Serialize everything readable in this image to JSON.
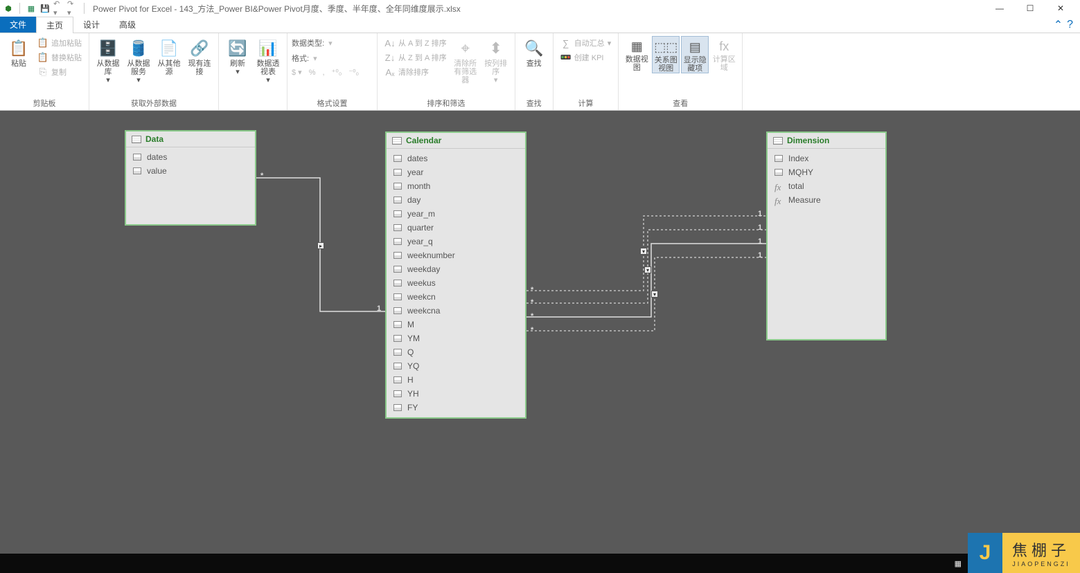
{
  "title": "Power Pivot for Excel - 143_方法_Power BI&Power Pivot月度、季度、半年度、全年同维度展示.xlsx",
  "tabs": {
    "file": "文件",
    "home": "主页",
    "design": "设计",
    "advanced": "高级"
  },
  "ribbon": {
    "clipboard": {
      "paste": "粘贴",
      "append": "追加粘贴",
      "replace": "替换粘贴",
      "copy": "复制",
      "label": "剪贴板"
    },
    "getdata": {
      "db": "从数据库",
      "svc": "从数据服务",
      "other": "从其他源",
      "existing": "现有连接",
      "label": "获取外部数据"
    },
    "refresh": "刷新",
    "pivot": "数据透视表",
    "format": {
      "datatype": "数据类型:",
      "fmt": "格式:",
      "label": "格式设置"
    },
    "sort": {
      "asc": "从 A 到 Z 排序",
      "desc": "从 Z 到 A 排序",
      "clear": "清除排序",
      "clearfilter": "清除所有筛选器",
      "bycol": "按列排序",
      "label": "排序和筛选"
    },
    "find": {
      "find": "查找",
      "label": "查找"
    },
    "calc": {
      "autosum": "自动汇总",
      "kpi": "创建 KPI",
      "label": "计算"
    },
    "view": {
      "dataview": "数据视图",
      "diagram": "关系图视图",
      "hidden": "显示隐藏项",
      "calcarea": "计算区域",
      "label": "查看"
    }
  },
  "tables": {
    "data": {
      "title": "Data",
      "fields": [
        "dates",
        "value"
      ]
    },
    "calendar": {
      "title": "Calendar",
      "fields": [
        "dates",
        "year",
        "month",
        "day",
        "year_m",
        "quarter",
        "year_q",
        "weeknumber",
        "weekday",
        "weekus",
        "weekcn",
        "weekcna",
        "M",
        "YM",
        "Q",
        "YQ",
        "H",
        "YH",
        "FY"
      ]
    },
    "dimension": {
      "title": "Dimension",
      "fields": [
        "Index",
        "MQHY"
      ],
      "measures": [
        "total",
        "Measure"
      ]
    }
  },
  "markers": {
    "star": "*",
    "one": "1"
  },
  "watermark": {
    "letter": "J",
    "name": "焦棚子",
    "sub": "JIAOPENGZI"
  },
  "win": {
    "min": "—",
    "max": "☐",
    "close": "✕"
  }
}
